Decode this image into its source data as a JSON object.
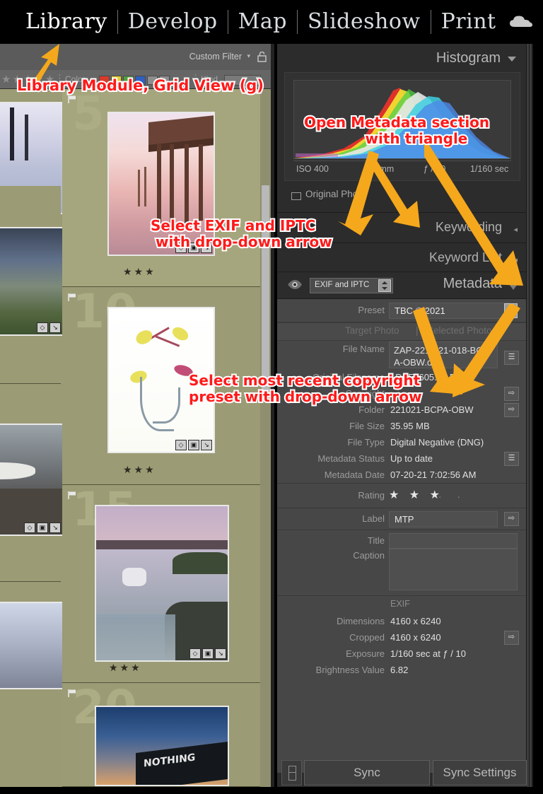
{
  "module_bar": {
    "modules": [
      {
        "label": "Library",
        "active": true
      },
      {
        "label": "Develop",
        "active": false
      },
      {
        "label": "Map",
        "active": false
      },
      {
        "label": "Slideshow",
        "active": false
      },
      {
        "label": "Print",
        "active": false
      }
    ],
    "cloud_icon": "cloud-icon"
  },
  "filter_bar": {
    "custom_filter_label": "Custom Filter",
    "lock_icon": "lock-icon",
    "attribute_label": "Color",
    "kind_label": "Kind",
    "swatch_colors": [
      "#d93b2b",
      "#e3d02a",
      "#4f9e3a",
      "#2f5fbf",
      "#8d8d8d",
      "#8d8d8d"
    ]
  },
  "grid": {
    "background_color": "#9a9a74",
    "cells": [
      {
        "number": "5",
        "rating": "★★★",
        "flag": "flag-icon",
        "badges": [
          "tag-badge",
          "crop-badge",
          "develop-badge"
        ],
        "image": "pier-sunset-photo"
      },
      {
        "number": "10",
        "rating": "★★★",
        "flag": "flag-icon",
        "badges": [
          "tag-badge",
          "crop-badge",
          "develop-badge"
        ],
        "image": "botanical-flower-photo"
      },
      {
        "number": "15",
        "rating": "★★★",
        "flag": "flag-icon",
        "badges": [
          "tag-badge",
          "crop-badge",
          "develop-badge"
        ],
        "image": "harbor-boat-photo"
      },
      {
        "number": "20",
        "rating": "",
        "flag": "flag-icon",
        "badges": [],
        "image": "nothing-sign-photo"
      }
    ],
    "left_column_cells": [
      {
        "image": "pilings-bw-photo",
        "badges": [
          "tag-badge",
          "develop-badge"
        ]
      },
      {
        "image": "marsh-dusk-photo",
        "badges": [
          "tag-badge",
          "develop-badge"
        ]
      },
      {
        "image": "dock-boat-photo",
        "badges": [
          "tag-badge",
          "crop-badge",
          "develop-badge"
        ]
      },
      {
        "image": "sky-photo",
        "badges": []
      }
    ]
  },
  "right_panel": {
    "histogram": {
      "title": "Histogram",
      "triangle_icon": "triangle-down-icon",
      "iso": "ISO 400",
      "focal_length": "55 mm",
      "aperture": "ƒ / 10",
      "shutter": "1/160 sec",
      "original_photo_label": "Original Photo"
    },
    "sections": [
      {
        "title": "Keywording",
        "icon": "collapse-arrow-icon"
      },
      {
        "title": "Keyword List",
        "icon": "collapse-arrow-icon"
      }
    ],
    "metadata": {
      "title": "Metadata",
      "triangle_icon": "triangle-open-icon",
      "eye_icon": "metadata-eye-icon",
      "view_select_value": "EXIF and IPTC",
      "preset_label": "Preset",
      "preset_value": "TBC © 2021",
      "target_photo_label": "Target Photo",
      "selected_photos_label": "Selected Photos",
      "separator": "|",
      "rows": [
        {
          "label": "File Name",
          "value": "ZAP-221-021-018-BCPA-OBW.dng",
          "field": true,
          "button": "list-button"
        },
        {
          "label": "Original Filename",
          "value": "_DSF7605.RAF",
          "field": false,
          "button": ""
        },
        {
          "label": "Copyright",
          "value": "",
          "field": false,
          "button": "goto-button"
        },
        {
          "label": "Folder",
          "value": "221021-BCPA-OBW",
          "field": false,
          "button": "goto-button"
        },
        {
          "label": "File Size",
          "value": "35.95 MB",
          "field": false,
          "button": ""
        },
        {
          "label": "File Type",
          "value": "Digital Negative (DNG)",
          "field": false,
          "button": ""
        },
        {
          "label": "Metadata Status",
          "value": "Up to date",
          "field": false,
          "button": "list-button"
        },
        {
          "label": "Metadata Date",
          "value": "07-20-21 7:02:56 AM",
          "field": false,
          "button": ""
        }
      ],
      "rating": {
        "label": "Rating",
        "stars": "★ ★ ★",
        "empty_dots": "·   ·"
      },
      "label_row": {
        "label": "Label",
        "value": "MTP",
        "button": "goto-button"
      },
      "title_row": {
        "label": "Title",
        "value": ""
      },
      "caption_row": {
        "label": "Caption",
        "value": ""
      },
      "exif_header": "EXIF",
      "exif_rows": [
        {
          "label": "Dimensions",
          "value": "4160 x 6240",
          "button": ""
        },
        {
          "label": "Cropped",
          "value": "4160 x 6240",
          "button": "goto-button"
        },
        {
          "label": "Exposure",
          "value": "1/160 sec at ƒ / 10",
          "button": ""
        },
        {
          "label": "Brightness Value",
          "value": "6.82",
          "button": ""
        }
      ]
    },
    "footer": {
      "sync_small_icon": "sync-toggle-icon",
      "sync_label": "Sync",
      "sync_settings_label": "Sync Settings"
    }
  },
  "annotations": [
    {
      "id": "ann-library",
      "text": "Library Module, Grid View (g)"
    },
    {
      "id": "ann-open-md",
      "text": "Open Metadata section\n        with triangle"
    },
    {
      "id": "ann-exif",
      "text": "Select EXIF and IPTC\n with drop-down arrow"
    },
    {
      "id": "ann-preset",
      "text": "Select most recent copyright\npreset with drop-down arrow"
    }
  ],
  "colors": {
    "annotation_text": "#ff1a1a",
    "annotation_outline": "#ffffff",
    "arrow": "#f5a81c",
    "panel_bg": "#474747",
    "grid_bg": "#9a9a74"
  }
}
